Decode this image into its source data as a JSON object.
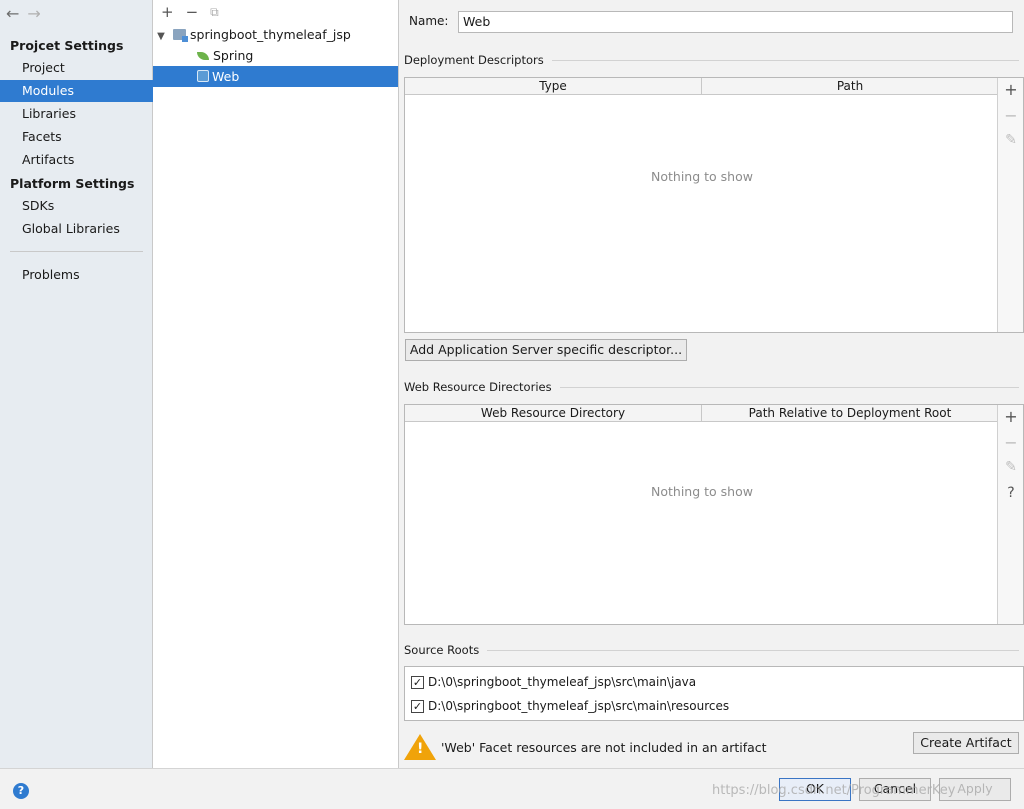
{
  "sidebar": {
    "back_icon": "arrow-left-icon",
    "forward_icon": "arrow-right-icon",
    "project_settings_header": "Projcet Settings",
    "project_items": [
      "Project",
      "Modules",
      "Libraries",
      "Facets",
      "Artifacts"
    ],
    "selected": "Modules",
    "platform_settings_header": "Platform Settings",
    "platform_items": [
      "SDKs",
      "Global Libraries"
    ],
    "problems": "Problems"
  },
  "tree": {
    "toolbar": [
      "plus-icon",
      "minus-icon",
      "copy-icon"
    ],
    "module": "springboot_thymeleaf_jsp",
    "facets": [
      "Spring",
      "Web"
    ],
    "selected": "Web"
  },
  "main": {
    "name_label": "Name:",
    "name_value": "Web",
    "deployment": {
      "title": "Deployment Descriptors",
      "columns": [
        "Type",
        "Path"
      ],
      "empty": "Nothing to show",
      "add_button": "Add Application Server specific descriptor..."
    },
    "web_resources": {
      "title": "Web Resource Directories",
      "columns": [
        "Web Resource Directory",
        "Path Relative to Deployment Root"
      ],
      "empty": "Nothing to show",
      "help": "?"
    },
    "source_roots": {
      "title": "Source Roots",
      "items": [
        {
          "path": "D:\\0\\springboot_thymeleaf_jsp\\src\\main\\java",
          "checked": true
        },
        {
          "path": "D:\\0\\springboot_thymeleaf_jsp\\src\\main\\resources",
          "checked": true
        }
      ]
    },
    "warning": "'Web' Facet resources are not included in an artifact",
    "create_artifact": "Create Artifact"
  },
  "footer": {
    "help": "?",
    "ok": "OK",
    "cancel": "Cancel",
    "apply": "Apply",
    "watermark": "https://blog.csdn.net/ProgrammerKey"
  }
}
